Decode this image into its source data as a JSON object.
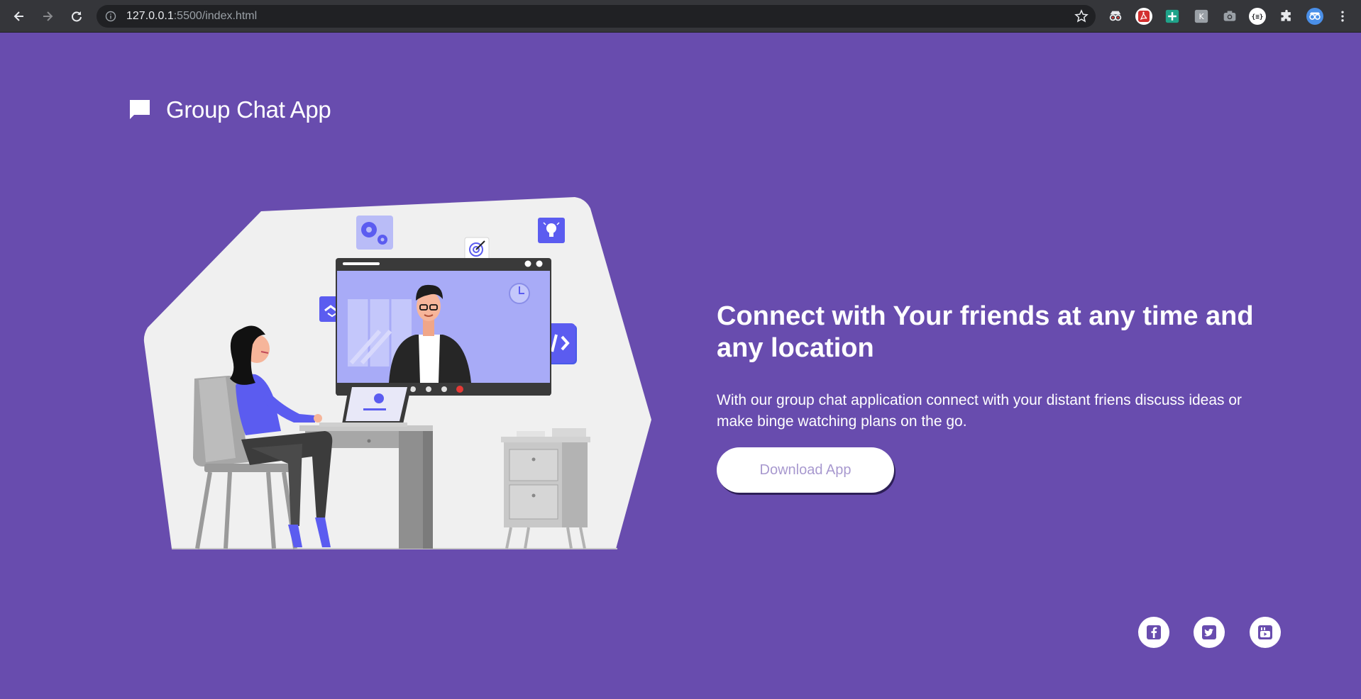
{
  "browser": {
    "url_host": "127.0.0.1",
    "url_rest": ":5500/index.html",
    "extensions": [
      "spy-extension-icon",
      "pdf-extension-icon",
      "plus-extension-icon",
      "k-extension-icon",
      "camera-extension-icon",
      "json-extension-icon",
      "puzzle-icon",
      "profile-avatar-icon",
      "menu-icon"
    ]
  },
  "brand": {
    "title": "Group Chat App"
  },
  "hero": {
    "title": "Connect with Your friends at any time and any location",
    "description": "With our group chat application connect with your distant friens discuss ideas or make binge watching plans on the go.",
    "button_label": "Download App"
  },
  "social": [
    "facebook-icon",
    "twitter-icon",
    "youtube-icon"
  ],
  "colors": {
    "background": "#684cae",
    "accent": "#5b5cf0",
    "button_text": "#a899cf"
  }
}
